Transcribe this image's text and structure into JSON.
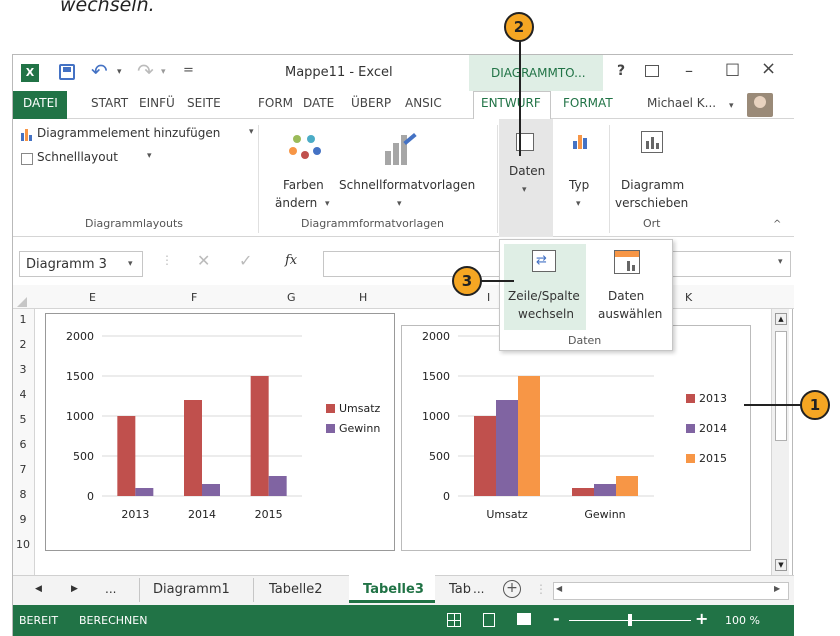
{
  "caption": "wechseln.",
  "titlebar": {
    "title": "Mappe11 - Excel",
    "context_tab": "DIAGRAMMTO...",
    "help": "?",
    "minimize": "–",
    "restore": "□",
    "close": "×"
  },
  "tabs": [
    "DATEI",
    "START",
    "EINFÜ",
    "SEITE",
    "FORM",
    "DATE",
    "ÜBERP",
    "ANSIC",
    "ENTWURF",
    "FORMAT"
  ],
  "user": "Michael K...",
  "ribbon": {
    "add_element": "Diagrammelement hinzufügen",
    "quick_layout": "Schnelllayout",
    "group_layouts": "Diagrammlayouts",
    "colors_line1": "Farben",
    "colors_line2": "ändern",
    "styles": "Schnellformatvorlagen",
    "group_styles": "Diagrammformatvorlagen",
    "data": "Daten",
    "type": "Typ",
    "move_line1": "Diagramm",
    "move_line2": "verschieben",
    "group_location": "Ort"
  },
  "dropdown": {
    "switch_line1": "Zeile/Spalte",
    "switch_line2": "wechseln",
    "select_line1": "Daten",
    "select_line2": "auswählen",
    "group": "Daten"
  },
  "formula": {
    "namebox": "Diagramm 3",
    "fx": "fx"
  },
  "columns": [
    "E",
    "F",
    "G",
    "H",
    "I",
    "K"
  ],
  "rows": [
    "1",
    "2",
    "3",
    "4",
    "5",
    "6",
    "7",
    "8",
    "9",
    "10"
  ],
  "sheettabs": {
    "ellipsis": "...",
    "tabs": [
      "Diagramm1",
      "Tabelle2",
      "Tabelle3",
      "Tab"
    ],
    "more": "...",
    "add": "+"
  },
  "status": {
    "ready": "BEREIT",
    "calc": "BERECHNEN",
    "zoom_minus": "-",
    "zoom_plus": "+",
    "zoom": "100 %",
    "zoom_level": 0.5
  },
  "callouts": [
    "1",
    "2",
    "3"
  ],
  "colors": {
    "accent": "#217346",
    "umsatz": "#c0504d",
    "gewinn": "#8064a2",
    "y2015": "#f79646",
    "callout": "#f5a623"
  },
  "chart_data": [
    {
      "type": "bar",
      "categories": [
        "2013",
        "2014",
        "2015"
      ],
      "series": [
        {
          "name": "Umsatz",
          "values": [
            1000,
            1200,
            1500
          ]
        },
        {
          "name": "Gewinn",
          "values": [
            100,
            150,
            250
          ]
        }
      ],
      "yticks": [
        "0",
        "500",
        "1000",
        "1500",
        "2000"
      ],
      "ylim": [
        0,
        2000
      ],
      "legend": "right"
    },
    {
      "type": "bar",
      "categories": [
        "Umsatz",
        "Gewinn"
      ],
      "series": [
        {
          "name": "2013",
          "values": [
            1000,
            100
          ]
        },
        {
          "name": "2014",
          "values": [
            1200,
            150
          ]
        },
        {
          "name": "2015",
          "values": [
            1500,
            250
          ]
        }
      ],
      "yticks": [
        "0",
        "500",
        "1000",
        "1500",
        "2000"
      ],
      "ylim": [
        0,
        2000
      ],
      "legend": "right"
    }
  ]
}
